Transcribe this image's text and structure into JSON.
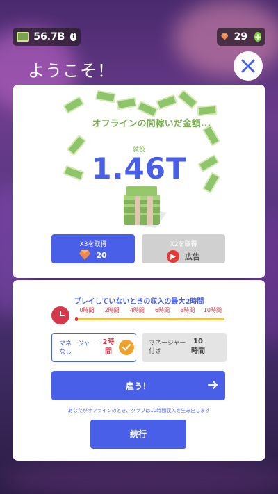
{
  "topbar": {
    "cash": "56.7B",
    "gems": "29"
  },
  "header": {
    "welcome": "ようこそ！"
  },
  "offline_card": {
    "title": "オフラインの間稼いだ金額...",
    "sub_label": "就役",
    "amount": "1.46T",
    "x3_label": "X3を取得",
    "x3_cost": "20",
    "x2_label": "X2を取得",
    "x2_action": "広告"
  },
  "manager_card": {
    "title": "プレイしていないときの収入の最大2時間",
    "ticks": [
      "0時間",
      "2時間",
      "4時間",
      "6時間",
      "8時間",
      "10時間"
    ],
    "progress_fraction": 0.02,
    "no_manager_label_1": "マネージャー",
    "no_manager_label_2": "なし",
    "no_manager_hours_1": "2時",
    "no_manager_hours_2": "間",
    "with_manager_label_1": "マネージャー",
    "with_manager_label_2": "付き",
    "with_manager_hours_1": "10",
    "with_manager_hours_2": "時間",
    "hire_label": "雇う！",
    "footnote": "あなたがオフラインのとき、クラブは10時間収入を生み出します",
    "continue_label": "続行"
  },
  "colors": {
    "accent": "#4a5fe8",
    "green_text": "#7bae52",
    "red": "#d5384a",
    "orange": "#f0a12a"
  }
}
